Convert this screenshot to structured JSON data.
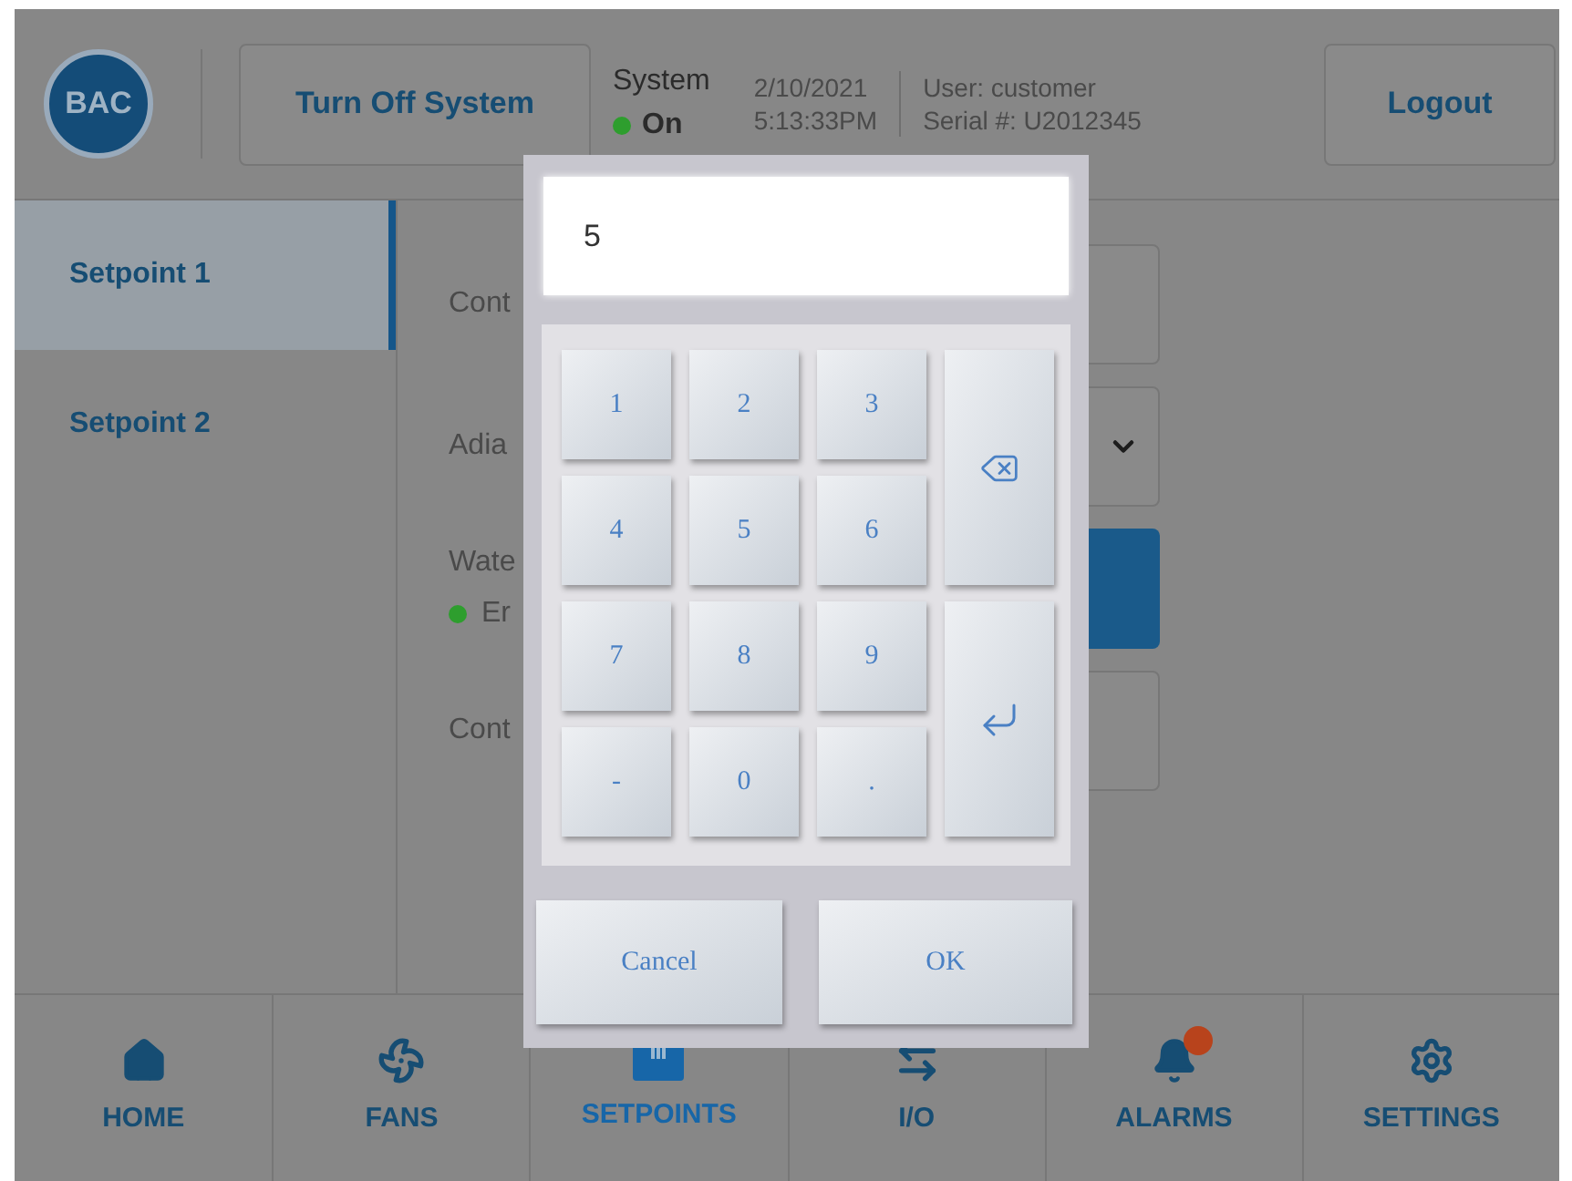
{
  "header": {
    "logo": "BAC",
    "turn_off_button": "Turn Off System",
    "system": {
      "label": "System",
      "status": "On",
      "on": true
    },
    "date": "2/10/2021",
    "time": "5:13:33PM",
    "user": "User: customer",
    "serial": "Serial #: U2012345",
    "logout_button": "Logout"
  },
  "sidebar": {
    "items": [
      {
        "label": "Setpoint 1",
        "selected": true
      },
      {
        "label": "Setpoint 2",
        "selected": false
      }
    ]
  },
  "content": {
    "rows": [
      {
        "kind": "input",
        "label": "Cont"
      },
      {
        "kind": "dropdown",
        "label": "Adia"
      },
      {
        "kind": "status",
        "label": "Wate",
        "status": "Er",
        "on": true
      },
      {
        "kind": "input",
        "label": "Cont"
      }
    ]
  },
  "keypad": {
    "value": "5",
    "keys": [
      {
        "kind": "digit",
        "label": "1"
      },
      {
        "kind": "digit",
        "label": "2"
      },
      {
        "kind": "digit",
        "label": "3"
      },
      {
        "kind": "backspace"
      },
      {
        "kind": "digit",
        "label": "4"
      },
      {
        "kind": "digit",
        "label": "5"
      },
      {
        "kind": "digit",
        "label": "6"
      },
      {
        "kind": "digit",
        "label": "7"
      },
      {
        "kind": "digit",
        "label": "8"
      },
      {
        "kind": "digit",
        "label": "9"
      },
      {
        "kind": "enter"
      },
      {
        "kind": "digit",
        "label": "-"
      },
      {
        "kind": "digit",
        "label": "0"
      },
      {
        "kind": "digit",
        "label": "."
      }
    ],
    "cancel_button": "Cancel",
    "ok_button": "OK"
  },
  "nav": {
    "items": [
      {
        "kind": "home",
        "label": "HOME",
        "selected": false
      },
      {
        "kind": "fans",
        "label": "FANS",
        "selected": false
      },
      {
        "kind": "setpoints",
        "label": "SETPOINTS",
        "selected": true
      },
      {
        "kind": "io",
        "label": "I/O",
        "selected": false
      },
      {
        "kind": "alarms",
        "label": "ALARMS",
        "selected": false,
        "alert": true
      },
      {
        "kind": "settings",
        "label": "SETTINGS",
        "selected": false
      }
    ]
  }
}
